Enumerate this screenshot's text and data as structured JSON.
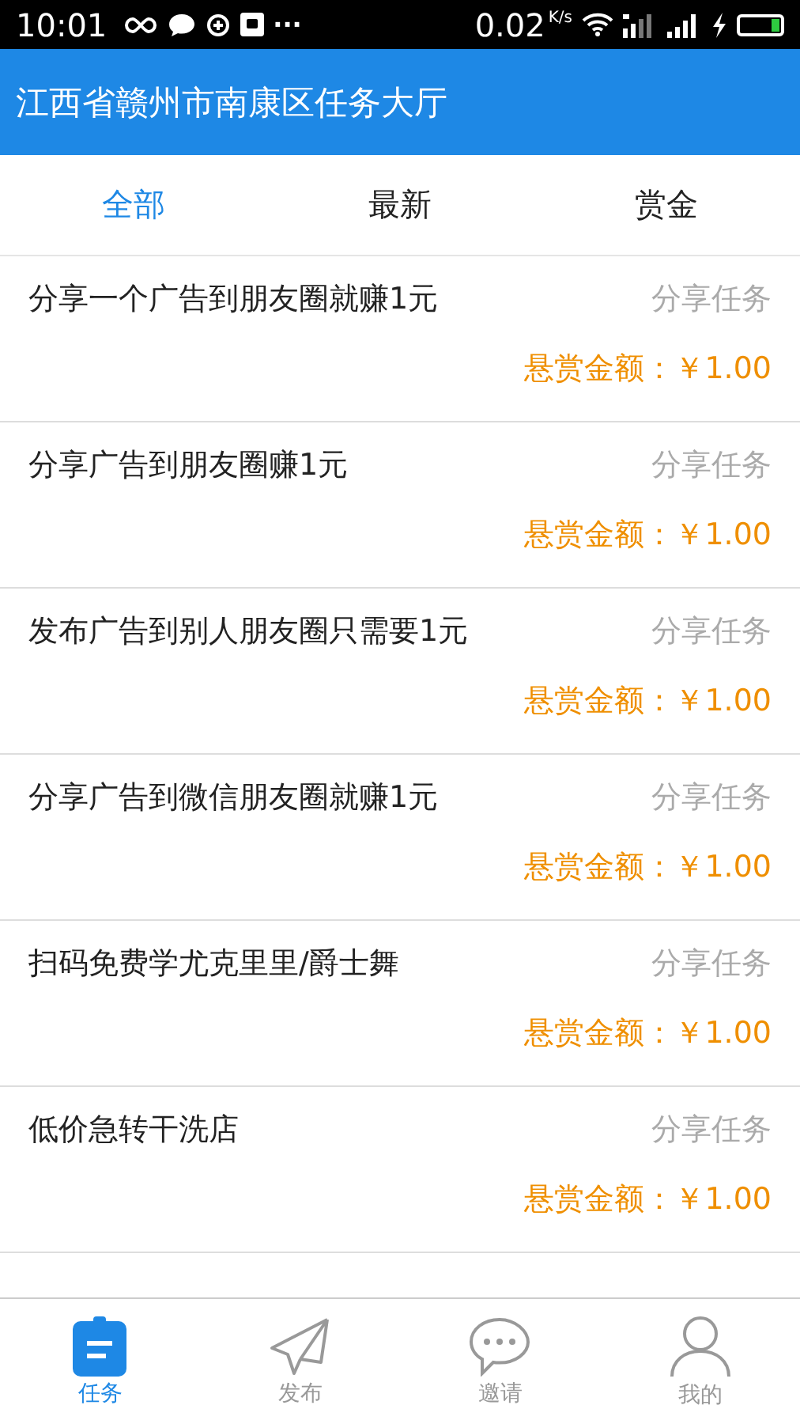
{
  "status_bar": {
    "time": "10:01",
    "more": "···",
    "speed": "0.02",
    "speed_unit": "K/s"
  },
  "header": {
    "title": "江西省赣州市南康区任务大厅"
  },
  "tabs": [
    {
      "label": "全部",
      "selected": true
    },
    {
      "label": "最新",
      "selected": false
    },
    {
      "label": "赏金",
      "selected": false
    }
  ],
  "tasks": [
    {
      "title": "分享一个广告到朋友圈就赚1元",
      "type": "分享任务",
      "reward": "悬赏金额：￥1.00"
    },
    {
      "title": "分享广告到朋友圈赚1元",
      "type": "分享任务",
      "reward": "悬赏金额：￥1.00"
    },
    {
      "title": "发布广告到别人朋友圈只需要1元",
      "type": "分享任务",
      "reward": "悬赏金额：￥1.00"
    },
    {
      "title": "分享广告到微信朋友圈就赚1元",
      "type": "分享任务",
      "reward": "悬赏金额：￥1.00"
    },
    {
      "title": "扫码免费学尤克里里/爵士舞",
      "type": "分享任务",
      "reward": "悬赏金额：￥1.00"
    },
    {
      "title": "低价急转干洗店",
      "type": "分享任务",
      "reward": "悬赏金额：￥1.00"
    }
  ],
  "bottom_nav": [
    {
      "label": "任务",
      "selected": true
    },
    {
      "label": "发布",
      "selected": false
    },
    {
      "label": "邀请",
      "selected": false
    },
    {
      "label": "我的",
      "selected": false
    }
  ]
}
